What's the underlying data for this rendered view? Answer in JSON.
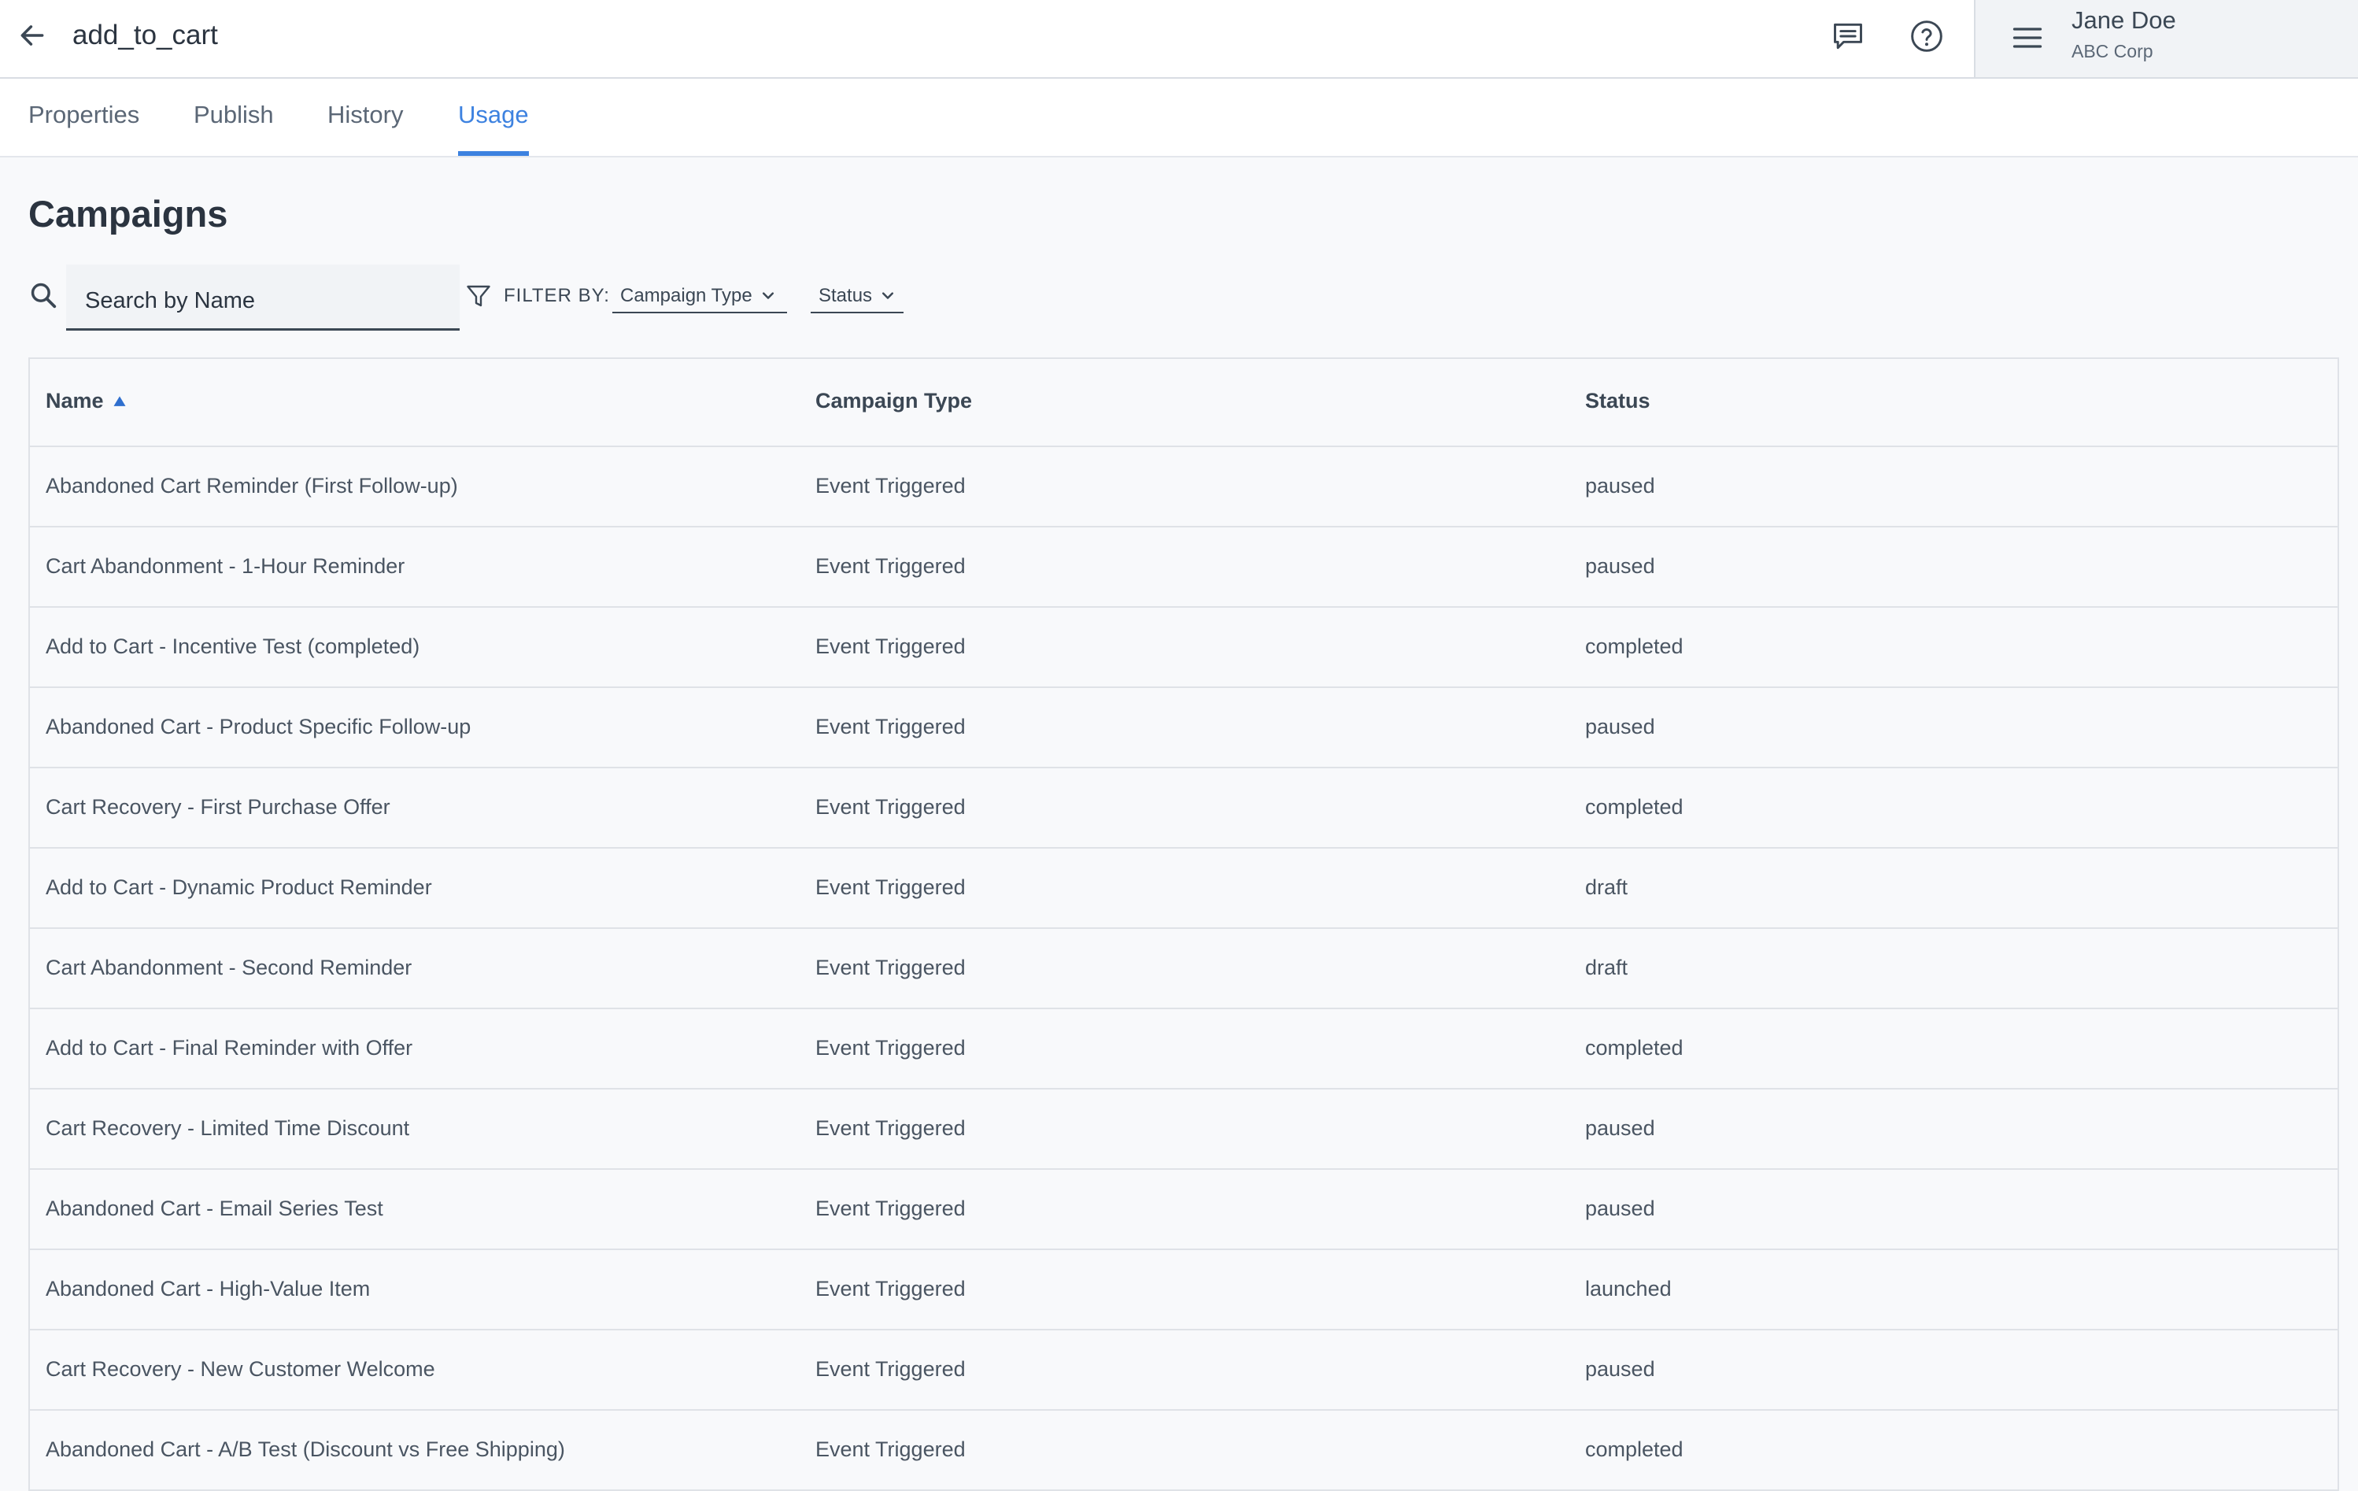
{
  "header": {
    "title": "add_to_cart",
    "back_icon": "arrow-left-icon",
    "comment_icon": "comment-icon",
    "help_icon": "help-icon",
    "menu_icon": "hamburger-menu-icon"
  },
  "user": {
    "name": "Jane Doe",
    "org": "ABC Corp"
  },
  "tabs": [
    {
      "label": "Properties"
    },
    {
      "label": "Publish"
    },
    {
      "label": "History"
    },
    {
      "label": "Usage",
      "active": true
    }
  ],
  "page": {
    "title": "Campaigns"
  },
  "search": {
    "placeholder": "Search by Name",
    "value": ""
  },
  "filters": {
    "label": "FILTER BY:",
    "campaign_type": "Campaign Type",
    "status": "Status"
  },
  "table": {
    "columns": [
      "Name",
      "Campaign Type",
      "Status"
    ],
    "sort": {
      "column": "Name",
      "direction": "ascending"
    },
    "rows": [
      {
        "name": "Abandoned Cart Reminder (First Follow-up)",
        "type": "Event Triggered",
        "status": "paused"
      },
      {
        "name": "Cart Abandonment - 1-Hour Reminder",
        "type": "Event Triggered",
        "status": "paused"
      },
      {
        "name": "Add to Cart - Incentive Test (completed)",
        "type": "Event Triggered",
        "status": "completed"
      },
      {
        "name": "Abandoned Cart - Product Specific Follow-up",
        "type": "Event Triggered",
        "status": "paused"
      },
      {
        "name": "Cart Recovery - First Purchase Offer",
        "type": "Event Triggered",
        "status": "completed"
      },
      {
        "name": "Add to Cart - Dynamic Product Reminder",
        "type": "Event Triggered",
        "status": "draft"
      },
      {
        "name": "Cart Abandonment - Second Reminder",
        "type": "Event Triggered",
        "status": "draft"
      },
      {
        "name": "Add to Cart - Final Reminder with Offer",
        "type": "Event Triggered",
        "status": "completed"
      },
      {
        "name": "Cart Recovery - Limited Time Discount",
        "type": "Event Triggered",
        "status": "paused"
      },
      {
        "name": "Abandoned Cart - Email Series Test",
        "type": "Event Triggered",
        "status": "paused"
      },
      {
        "name": "Abandoned Cart - High-Value Item",
        "type": "Event Triggered",
        "status": "launched"
      },
      {
        "name": "Cart Recovery - New Customer Welcome",
        "type": "Event Triggered",
        "status": "paused"
      },
      {
        "name": "Abandoned Cart - A/B Test (Discount vs Free Shipping)",
        "type": "Event Triggered",
        "status": "completed"
      }
    ]
  },
  "colors": {
    "accent": "#3d82e0",
    "text": "#3b4754",
    "background": "#f8f9fb"
  }
}
